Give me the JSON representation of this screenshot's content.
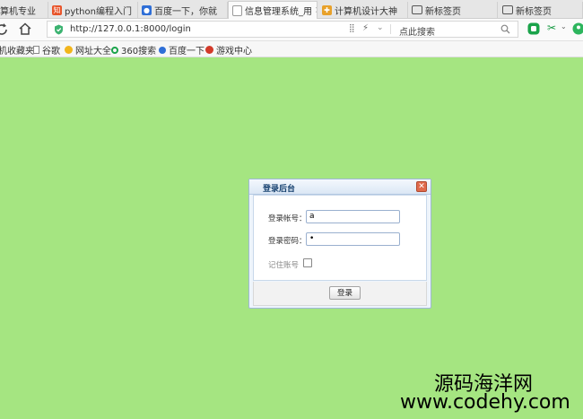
{
  "browser": {
    "tabs": [
      {
        "label": "算机专业",
        "close": ""
      },
      {
        "label": "python编程入门",
        "close": ""
      },
      {
        "label": "百度一下，你就",
        "close": ""
      },
      {
        "label": "信息管理系统_用",
        "close": "×"
      },
      {
        "label": "计算机设计大神",
        "close": ""
      },
      {
        "label": "新标签页",
        "close": ""
      },
      {
        "label": "新标签页",
        "close": ""
      }
    ],
    "url": "http://127.0.0.1:8000/login",
    "search_placeholder": "点此搜索",
    "bookmarks": [
      "机收藏夹",
      "谷歌",
      "网址大全",
      "360搜索",
      "百度一下",
      "游戏中心"
    ]
  },
  "login": {
    "title": "登录后台",
    "close_glyph": "✕",
    "account_label": "登录帐号：",
    "account_value": "a",
    "password_label": "登录密码：",
    "password_value": "•",
    "remember_label": "记住账号",
    "submit_label": "登录"
  },
  "watermark": {
    "name": "源码海洋网",
    "url": "www.codehy.com"
  },
  "colors": {
    "page_bg": "#a5e581",
    "dialog_border": "#9fb8d6",
    "close_button": "#e06a4c"
  }
}
